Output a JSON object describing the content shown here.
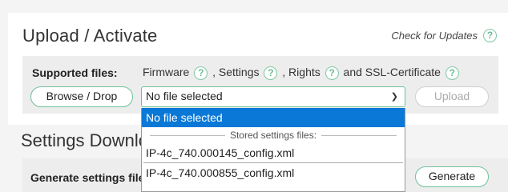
{
  "upload": {
    "title": "Upload / Activate",
    "check_updates": "Check for Updates",
    "supported_label": "Supported files:",
    "types": [
      "Firmware",
      ", Settings",
      ", Rights",
      "and SSL-Certificate"
    ],
    "help_glyph": "?",
    "browse_label": "Browse / Drop",
    "file_select_value": "No file selected",
    "upload_label": "Upload"
  },
  "dropdown": {
    "selected_option": "No file selected",
    "group_label": "Stored settings files:",
    "options": [
      "IP-4c_740.000145_config.xml",
      "IP-4c_740.000855_config.xml"
    ]
  },
  "settings": {
    "title": "Settings Downlo",
    "generate_label": "Generate settings file",
    "generate_button": "Generate"
  },
  "colors": {
    "accent": "#6ec199",
    "selected_option": "#0a78d7"
  }
}
